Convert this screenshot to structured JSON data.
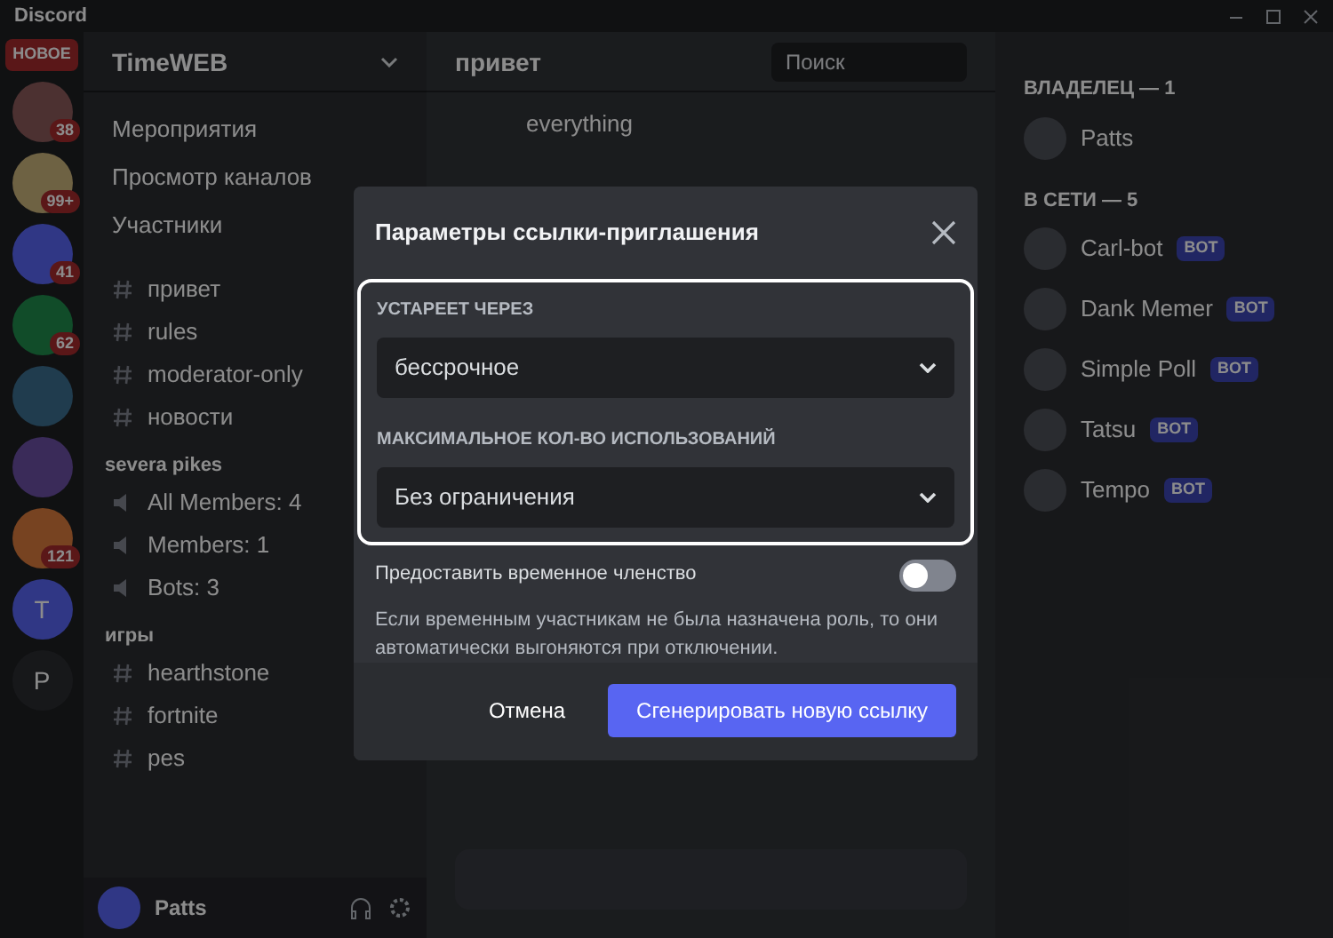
{
  "window": {
    "title": "Discord"
  },
  "servers": [
    {
      "kind": "label",
      "badge": "НОВОЕ"
    },
    {
      "kind": "icon",
      "badge": "38"
    },
    {
      "kind": "icon",
      "badge": "99+"
    },
    {
      "kind": "icon",
      "badge": "41"
    },
    {
      "kind": "icon",
      "badge": "62"
    },
    {
      "kind": "icon"
    },
    {
      "kind": "icon"
    },
    {
      "kind": "icon",
      "badge": "121"
    },
    {
      "kind": "letter",
      "letter": "T"
    },
    {
      "kind": "letter",
      "letter": "P"
    }
  ],
  "server": {
    "name": "TimeWEB"
  },
  "sidebar": {
    "items": [
      {
        "label": "Мероприятия"
      },
      {
        "label": "Просмотр каналов"
      },
      {
        "label": "Участники"
      }
    ],
    "channels": [
      {
        "kind": "text",
        "label": "привет"
      },
      {
        "kind": "text",
        "label": "rules"
      },
      {
        "kind": "text",
        "label": "moderator-only"
      },
      {
        "kind": "text",
        "label": "новости"
      },
      {
        "kind": "category",
        "label": "severa pikes"
      },
      {
        "kind": "voice",
        "label": "All Members: 4"
      },
      {
        "kind": "voice",
        "label": "Members: 1"
      },
      {
        "kind": "voice",
        "label": "Bots: 3"
      },
      {
        "kind": "category",
        "label": "игры"
      },
      {
        "kind": "text",
        "label": "hearthstone"
      },
      {
        "kind": "text",
        "label": "fortnite"
      },
      {
        "kind": "text",
        "label": "pes"
      }
    ]
  },
  "user": {
    "name": "Patts"
  },
  "channel_header": {
    "title": "привет",
    "search_placeholder": "Поиск"
  },
  "messages": [
    {
      "text": "everything"
    }
  ],
  "members": {
    "groups": [
      {
        "title": "ВЛАДЕЛЕЦ — 1",
        "members": [
          {
            "name": "Patts"
          }
        ]
      },
      {
        "title": "В СЕТИ — 5",
        "members": [
          {
            "name": "Carl-bot",
            "tag": "BOT"
          },
          {
            "name": "Dank Memer",
            "tag": "BOT"
          },
          {
            "name": "Simple Poll",
            "tag": "BOT"
          },
          {
            "name": "Tatsu",
            "tag": "BOT"
          },
          {
            "name": "Tempo",
            "tag": "BOT"
          }
        ]
      }
    ]
  },
  "dialog": {
    "title": "Параметры ссылки-приглашения",
    "dropdowns": [
      {
        "label": "УСТАРЕЕТ ЧЕРЕЗ",
        "value": "бессрочное"
      },
      {
        "label": "МАКСИМАЛЬНОЕ КОЛ-ВО ИСПОЛЬЗОВАНИЙ",
        "value": "Без ограничения"
      }
    ],
    "toggle": {
      "label": "Предоставить временное членство",
      "on": false,
      "description": "Если временным участникам не была назначена роль, то они автоматически выгоняются при отключении."
    },
    "buttons": [
      {
        "kind": "secondary",
        "label": "Отмена"
      },
      {
        "kind": "primary",
        "label": "Сгенерировать новую ссылку"
      }
    ]
  }
}
